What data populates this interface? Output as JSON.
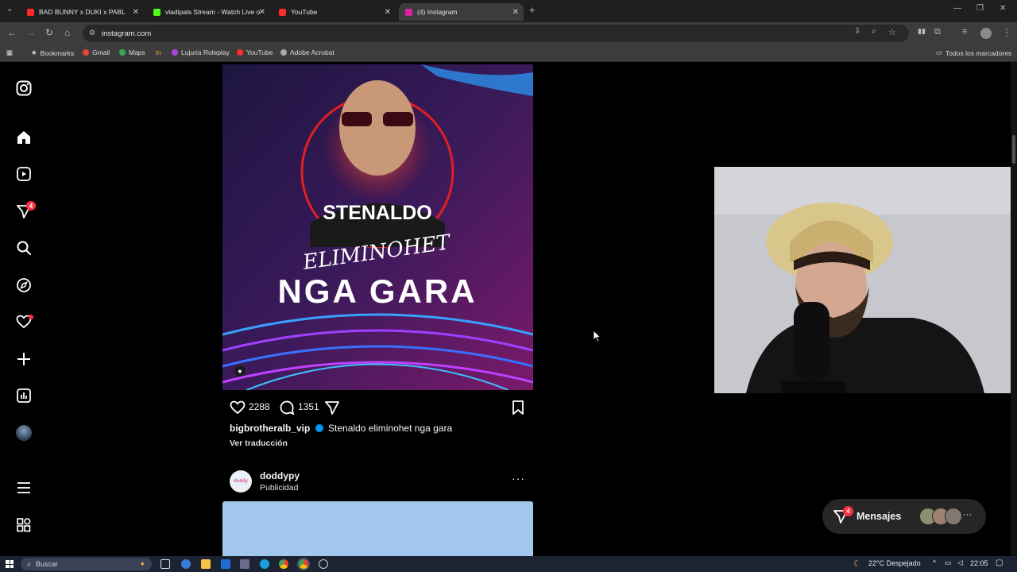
{
  "browser": {
    "tabs": [
      {
        "label": "BAD BUNNY x DUKI x PABL",
        "color": "#ff2a2a"
      },
      {
        "label": "vladipals Stream - Watch Live o",
        "color": "#53fc18"
      },
      {
        "label": "YouTube",
        "color": "#ff2a2a"
      },
      {
        "label": "(4) Instagram",
        "color": "#d6249f"
      }
    ],
    "url": "instagram.com",
    "bookmarks": [
      {
        "label": "Bookmarks"
      },
      {
        "label": "Gmail"
      },
      {
        "label": "Maps"
      },
      {
        "label": "in"
      },
      {
        "label": "Lujuria Roleplay"
      },
      {
        "label": "YouTube"
      },
      {
        "label": "Adobe Acrobat"
      }
    ],
    "bookmarks_folder": "Todos los marcadores"
  },
  "sidebar": {
    "notification_badge": "4",
    "icons": [
      "instagram-logo-icon",
      "home-icon",
      "reels-icon",
      "messages-icon",
      "search-icon",
      "explore-icon",
      "heart-icon",
      "create-icon",
      "dashboard-icon",
      "profile-avatar",
      "menu-icon",
      "more-apps-icon"
    ]
  },
  "post": {
    "image": {
      "name_text": "STENALDO",
      "script_text": "ELIMINOHET",
      "headline_text": "NGA GARA"
    },
    "likes": "2288",
    "comments": "1351",
    "username": "bigbrotheralb_vip",
    "caption": "Stenaldo eliminohet nga gara",
    "translate_label": "Ver traducción"
  },
  "ad_post": {
    "username": "doddypy",
    "sublabel": "Publicidad",
    "avatar_text": "doddy"
  },
  "messages": {
    "label": "Mensajes",
    "badge": "4"
  },
  "taskbar": {
    "search_placeholder": "Buscar",
    "weather": "22°C  Despejado",
    "time": "22:05"
  },
  "colors": {
    "accent_red": "#ff3040",
    "verified_blue": "#0095f6",
    "background": "#000000"
  }
}
